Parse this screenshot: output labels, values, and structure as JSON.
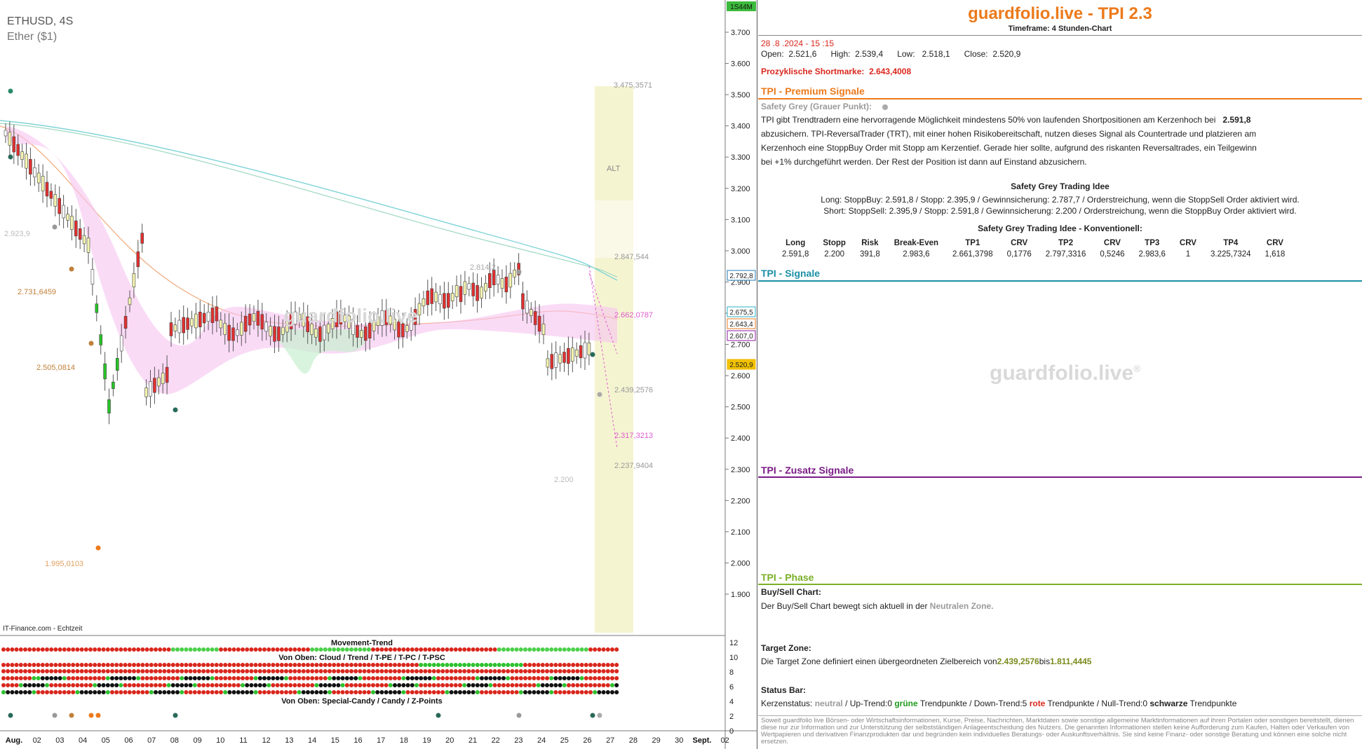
{
  "chart": {
    "symbol": "ETHUSD, 4S",
    "name": "Ether ($1)",
    "watermark": "guardfolio.live",
    "source": "IT-Finance.com - Echtzeit",
    "time_badge": "1S44M",
    "price_axis": [
      "3.700",
      "3.600",
      "3.500",
      "3.400",
      "3.300",
      "3.200",
      "3.100",
      "3.000",
      "2.900",
      "2.800",
      "2.700",
      "2.600",
      "2.500",
      "2.400",
      "2.300",
      "2.200",
      "2.100",
      "2.000",
      "1.900"
    ],
    "price_badges": [
      {
        "value": "2.792,8",
        "color": "#1f77b4"
      },
      {
        "value": "2.675,5",
        "color": "#29b0c8"
      },
      {
        "value": "2.643,4",
        "color": "#ec7a1c"
      },
      {
        "value": "2.607,0",
        "color": "#8e1aa0"
      },
      {
        "value": "2.520,9",
        "color": "#f2b600"
      }
    ],
    "level_labels": [
      {
        "text": "3.475,3571",
        "color": "#999"
      },
      {
        "text": "ALT",
        "color": "#888"
      },
      {
        "text": "2.847,544",
        "color": "#999"
      },
      {
        "text": "2.814,2",
        "color": "#aaa"
      },
      {
        "text": "2.662,0787",
        "color": "#e05bd0"
      },
      {
        "text": "2.439,2576",
        "color": "#999"
      },
      {
        "text": "2.317,3213",
        "color": "#e05bd0"
      },
      {
        "text": "2.237,9404",
        "color": "#999"
      },
      {
        "text": "2.200",
        "color": "#bbb"
      },
      {
        "text": "2.923,9",
        "color": "#bbb"
      },
      {
        "text": "2.731,6459",
        "color": "#c0803a"
      },
      {
        "text": "2.505,0814",
        "color": "#c0803a"
      },
      {
        "text": "1.995,0103",
        "color": "#e0a060"
      }
    ],
    "date_axis": [
      "Aug.",
      "02",
      "03",
      "04",
      "05",
      "06",
      "07",
      "08",
      "09",
      "10",
      "11",
      "12",
      "13",
      "14",
      "15",
      "16",
      "17",
      "18",
      "19",
      "20",
      "21",
      "22",
      "23",
      "24",
      "25",
      "26",
      "27",
      "28",
      "29",
      "30",
      "Sept.",
      "02"
    ],
    "sub_panels": {
      "movement_trend": "Movement-Trend",
      "von_oben_cloud": "Von Oben: Cloud / Trend / T-PE / T-PC / T-PSC",
      "von_oben_special": "Von Oben: Special-Candy / Candy / Z-Points",
      "scale": [
        "12",
        "10",
        "8",
        "6",
        "4",
        "2",
        "0"
      ]
    }
  },
  "info": {
    "title": "guardfolio.live - TPI 2.3",
    "timeframe": "Timeframe: 4 Stunden-Chart",
    "datetime": "28 .8 .2024  - 15 :15",
    "ohlc": {
      "open_label": "Open:",
      "open": "2.521,6",
      "high_label": "High:",
      "high": "2.539,4",
      "low_label": "Low:",
      "low": "2.518,1",
      "close_label": "Close:",
      "close": "2.520,9"
    },
    "shortmarke_label": "Prozyklische Shortmarke:",
    "shortmarke_value": "2.643,4008",
    "premium": {
      "title": "TPI - Premium Signale",
      "safety_label": "Safety Grey (Grauer Punkt):",
      "line1": "TPI gibt Trendtradern eine hervorragende Möglichkeit mindestens 50% von laufenden Shortpositionen am Kerzenhoch bei",
      "line1_value": "2.591,8",
      "line2": "abzusichern. TPI-ReversalTrader (TRT), mit einer hohen Risikobereitschaft, nutzen dieses Signal als Countertrade und platzieren am",
      "line3": "Kerzenhoch eine StoppBuy Order mit Stopp am Kerzentief. Gerade hier sollte, aufgrund des riskanten Reversaltrades, ein Teilgewinn",
      "line4": "bei +1% durchgeführt werden. Der Rest der Position ist dann auf Einstand abzusichern.",
      "idea_title": "Safety Grey Trading Idee",
      "idea_long": "Long: StoppBuy:   2.591,8   / Stopp:  2.395,9   / Gewinnsicherung: 2.787,7    / Orderstreichung, wenn die StoppSell Order aktiviert wird.",
      "idea_short": "Short: StoppSell:   2.395,9  / Stopp:  2.591,8  / Gewinnsicherung:  2.200     / Orderstreichung, wenn die StoppBuy Order aktiviert wird.",
      "konv_title": "Safety Grey Trading Idee - Konventionell:",
      "table_headers": [
        "Long",
        "Stopp",
        "Risk",
        "Break-Even",
        "TP1",
        "CRV",
        "TP2",
        "CRV",
        "TP3",
        "CRV",
        "TP4",
        "CRV"
      ],
      "table_values": [
        "2.591,8",
        "2.200",
        "391,8",
        "2.983,6",
        "2.661,3798",
        "0,1776",
        "2.797,3316",
        "0,5246",
        "2.983,6",
        "1",
        "3.225,7324",
        "1,618"
      ]
    },
    "signale_title": "TPI - Signale",
    "watermark": "guardfolio.live",
    "zusatz_title": "TPI - Zusatz Signale",
    "phase": {
      "title": "TPI - Phase",
      "buysell_label": "Buy/Sell Chart:",
      "buysell_text": "Der Buy/Sell Chart bewegt sich aktuell in der",
      "buysell_zone": "Neutralen Zone.",
      "target_label": "Target Zone:",
      "target_text": "Die Target Zone definiert einen übergeordneten Zielbereich von",
      "target_from": "2.439,2576",
      "target_bis": "bis",
      "target_to": "1.811,4445",
      "status_label": "Status Bar:",
      "status_kerzen": "Kerzenstatus:",
      "status_neutral": "neutral",
      "status_up": "/ Up-Trend:0",
      "status_gruene": "grüne",
      "status_tp1": "Trendpunkte  / Down-Trend:5",
      "status_rote": "rote",
      "status_tp2": "Trendpunkte  / Null-Trend:0",
      "status_schwarze": "schwarze",
      "status_tp3": "Trendpunkte"
    },
    "disclaimer": "Soweit guardfolio live Börsen- oder Wirtschaftsinformationen, Kurse, Preise, Nachrichten, Marktdaten sowie sonstige allgemeine Marktinformationen auf ihren Portalen oder sonstigen bereitstellt, dienen diese nur zur Information und zur Unterstützung der selbstständigen Anlageentscheidung des Nutzers. Die genannten Informationen stellen keine Aufforderung zum Kaufen, Halten oder Verkaufen von Wertpapieren und derivativen Finanzprodukten dar und begründen kein individuelles Beratungs- oder Auskunftsverhältnis. Sie sind keine Finanz- oder sonstige Beratung und können eine solche nicht ersetzen."
  },
  "colors": {
    "orange": "#ec7a1c",
    "teal": "#1b8fa6",
    "purple": "#7a1a86",
    "green": "#7bb026",
    "red": "#d9271d"
  }
}
